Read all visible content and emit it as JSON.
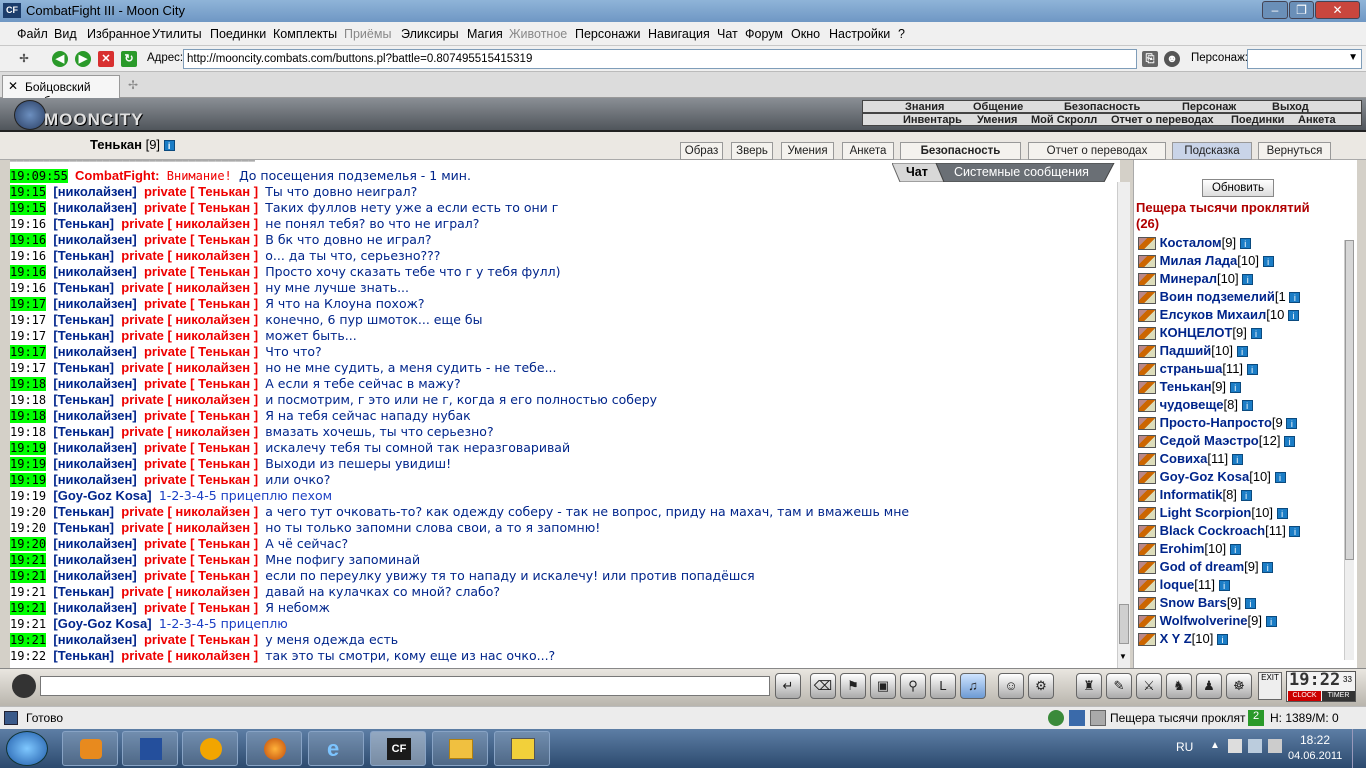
{
  "window": {
    "title": "CombatFight III - Moon City",
    "logo": "CF"
  },
  "menu": [
    "Файл",
    "Вид",
    "Избранное",
    "Утилиты",
    "Поединки",
    "Комплекты",
    "Приёмы",
    "Эликсиры",
    "Магия",
    "Животное",
    "Персонажи",
    "Навигация",
    "Чат",
    "Форум",
    "Окно",
    "Настройки",
    "?"
  ],
  "addressbar": {
    "label": "Адрес:",
    "url": "http://mooncity.combats.com/buttons.pl?battle=0.807495515415319",
    "persona_label": "Персонаж:"
  },
  "tab": {
    "label": "Бойцовский клуб"
  },
  "game": {
    "logo_text": "MOONCITY",
    "nav_top": [
      "Знания",
      "Общение",
      "Безопасность",
      "Персонаж",
      "Выход"
    ],
    "nav_bottom": [
      "Инвентарь",
      "Умения",
      "Мой Скролл",
      "Отчет о переводах",
      "Поединки",
      "Анкета"
    ],
    "character": {
      "name": "Тенькан",
      "level": "[9]"
    },
    "buttons": [
      "Образ",
      "Зверь",
      "Умения",
      "Анкета",
      "Безопасность",
      "Отчет о переводах",
      "Подсказка",
      "Вернуться"
    ],
    "chat_tabs": {
      "chat": "Чат",
      "system": "Системные сообщения"
    }
  },
  "chat": {
    "system_line": {
      "time": "19:09:55",
      "source": "CombatFight:",
      "attention": "Внимание!",
      "text": "До посещения подземелья - 1 мин."
    },
    "messages": [
      {
        "time": "19:15",
        "from": "николайзен",
        "priv": "private [ Тенькан ]",
        "text": "Ты что довно неиграл?",
        "hl": true
      },
      {
        "time": "19:15",
        "from": "николайзен",
        "priv": "private [ Тенькан ]",
        "text": "Таких фуллов нету уже а если есть то они г",
        "hl": true
      },
      {
        "time": "19:16",
        "from": "Тенькан",
        "priv": "private [ николайзен ]",
        "text": "не понял тебя? во что не играл?",
        "hl": false
      },
      {
        "time": "19:16",
        "from": "николайзен",
        "priv": "private [ Тенькан ]",
        "text": "В бк что довно не играл?",
        "hl": true
      },
      {
        "time": "19:16",
        "from": "Тенькан",
        "priv": "private [ николайзен ]",
        "text": "о... да ты что, серьезно???",
        "hl": false
      },
      {
        "time": "19:16",
        "from": "николайзен",
        "priv": "private [ Тенькан ]",
        "text": "Просто хочу сказать тебе что г у тебя фулл)",
        "hl": true
      },
      {
        "time": "19:16",
        "from": "Тенькан",
        "priv": "private [ николайзен ]",
        "text": "ну мне лучше знать...",
        "hl": false
      },
      {
        "time": "19:17",
        "from": "николайзен",
        "priv": "private [ Тенькан ]",
        "text": "Я что на Клоуна похож?",
        "hl": true
      },
      {
        "time": "19:17",
        "from": "Тенькан",
        "priv": "private [ николайзен ]",
        "text": "конечно, 6 пур шмоток... еще бы",
        "hl": false
      },
      {
        "time": "19:17",
        "from": "Тенькан",
        "priv": "private [ николайзен ]",
        "text": "может быть...",
        "hl": false
      },
      {
        "time": "19:17",
        "from": "николайзен",
        "priv": "private [ Тенькан ]",
        "text": "Что что?",
        "hl": true
      },
      {
        "time": "19:17",
        "from": "Тенькан",
        "priv": "private [ николайзен ]",
        "text": "но не мне судить, а меня судить - не тебе...",
        "hl": false
      },
      {
        "time": "19:18",
        "from": "николайзен",
        "priv": "private [ Тенькан ]",
        "text": "А если я тебе сейчас в мажу?",
        "hl": true
      },
      {
        "time": "19:18",
        "from": "Тенькан",
        "priv": "private [ николайзен ]",
        "text": "и посмотрим, г это или не г, когда я его полностью соберу",
        "hl": false
      },
      {
        "time": "19:18",
        "from": "николайзен",
        "priv": "private [ Тенькан ]",
        "text": "Я на тебя сейчас нападу нубак",
        "hl": true
      },
      {
        "time": "19:18",
        "from": "Тенькан",
        "priv": "private [ николайзен ]",
        "text": "вмазать хочешь, ты что серьезно?",
        "hl": false
      },
      {
        "time": "19:19",
        "from": "николайзен",
        "priv": "private [ Тенькан ]",
        "text": "искалечу тебя ты сомной так неразговаривай",
        "hl": true
      },
      {
        "time": "19:19",
        "from": "николайзен",
        "priv": "private [ Тенькан ]",
        "text": "Выходи из пешеры увидиш!",
        "hl": true
      },
      {
        "time": "19:19",
        "from": "николайзен",
        "priv": "private [ Тенькан ]",
        "text": "или очко?",
        "hl": true
      },
      {
        "time": "19:19",
        "from": "Goy-Goz Kosa",
        "priv": "",
        "text": "1-2-3-4-5 прицеплю пехом",
        "hl": false
      },
      {
        "time": "19:20",
        "from": "Тенькан",
        "priv": "private [ николайзен ]",
        "text": "а чего тут очковать-то? как одежду соберу - так не вопрос, приду на махач, там и вмажешь мне",
        "hl": false
      },
      {
        "time": "19:20",
        "from": "Тенькан",
        "priv": "private [ николайзен ]",
        "text": "но ты только запомни слова свои, а то я запомню!",
        "hl": false
      },
      {
        "time": "19:20",
        "from": "николайзен",
        "priv": "private [ Тенькан ]",
        "text": "А чё сейчас?",
        "hl": true
      },
      {
        "time": "19:21",
        "from": "николайзен",
        "priv": "private [ Тенькан ]",
        "text": "Мне пофигу запоминай",
        "hl": true
      },
      {
        "time": "19:21",
        "from": "николайзен",
        "priv": "private [ Тенькан ]",
        "text": "если по переулку увижу тя то нападу и искалечу! или против попадёшся",
        "hl": true
      },
      {
        "time": "19:21",
        "from": "Тенькан",
        "priv": "private [ николайзен ]",
        "text": "давай на кулачках со мной? слабо?",
        "hl": false
      },
      {
        "time": "19:21",
        "from": "николайзен",
        "priv": "private [ Тенькан ]",
        "text": "Я небомж",
        "hl": true
      },
      {
        "time": "19:21",
        "from": "Goy-Goz Kosa",
        "priv": "",
        "text": "1-2-3-4-5 прицеплю",
        "hl": false
      },
      {
        "time": "19:21",
        "from": "николайзен",
        "priv": "private [ Тенькан ]",
        "text": "у меня одежда есть",
        "hl": true
      },
      {
        "time": "19:22",
        "from": "Тенькан",
        "priv": "private [ николайзен ]",
        "text": "так это ты смотри, кому еще из нас очко...?",
        "hl": false
      }
    ]
  },
  "room": {
    "refresh": "Обновить",
    "title": "Пещера тысячи проклятий",
    "count": "(26)",
    "users": [
      {
        "name": "Косталом",
        "level": "[9]"
      },
      {
        "name": "Милая Лада",
        "level": "[10]"
      },
      {
        "name": "Минерал",
        "level": "[10]"
      },
      {
        "name": "Воин подземелий",
        "level": "[1"
      },
      {
        "name": "Елсуков Михаил",
        "level": "[10"
      },
      {
        "name": "КОНЦЕЛОТ",
        "level": "[9]"
      },
      {
        "name": "Падший",
        "level": "[10]"
      },
      {
        "name": "страньша",
        "level": "[11]"
      },
      {
        "name": "Тенькан",
        "level": "[9]"
      },
      {
        "name": "чудовеще",
        "level": "[8]"
      },
      {
        "name": "Просто-Напросто",
        "level": "[9"
      },
      {
        "name": "Седой Маэстро",
        "level": "[12]"
      },
      {
        "name": "Совиха",
        "level": "[11]"
      },
      {
        "name": "Goy-Goz Kosa",
        "level": "[10]"
      },
      {
        "name": "Informatik",
        "level": "[8]"
      },
      {
        "name": "Light Scorpion",
        "level": "[10]"
      },
      {
        "name": "Black Cockroach",
        "level": "[11]"
      },
      {
        "name": "Erohim",
        "level": "[10]"
      },
      {
        "name": "God of dream",
        "level": "[9]"
      },
      {
        "name": "loque",
        "level": "[11]"
      },
      {
        "name": "Snow Bars",
        "level": "[9]"
      },
      {
        "name": "Wolfwolverine",
        "level": "[9]"
      },
      {
        "name": "X Y Z",
        "level": "[10]"
      }
    ]
  },
  "clock": {
    "time": "19:22",
    "sec": "33",
    "clock_label": "CLOCK",
    "timer_label": "TIMER",
    "exit": "EXIT"
  },
  "status": {
    "text": "Готово",
    "location": "Пещера тысячи проклят",
    "hp": "H: 1389/M: 0"
  },
  "taskbar": {
    "lang": "RU",
    "time": "18:22",
    "date": "04.06.2011"
  }
}
